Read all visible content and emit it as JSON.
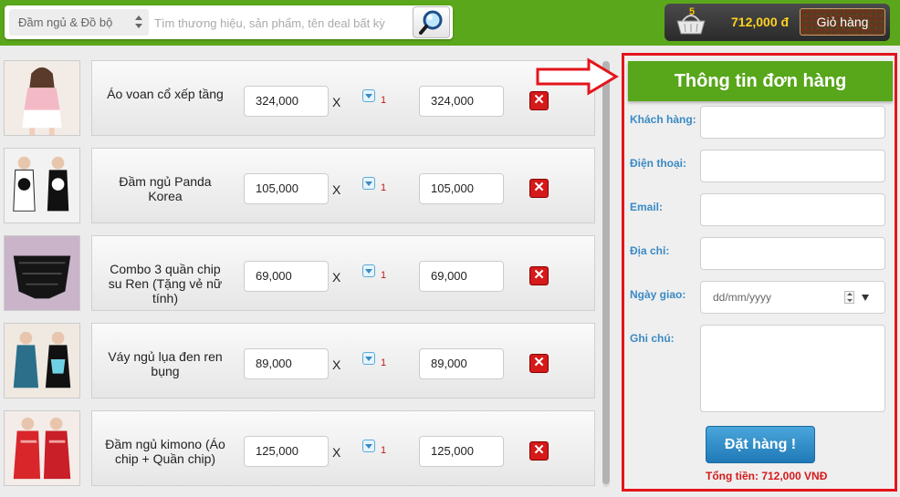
{
  "header": {
    "category_select": "Đầm ngủ & Đồ bộ",
    "search_placeholder": "Tìm thương hiệu, sản phẩm, tên deal bất kỳ",
    "cart_count": "5",
    "cart_total": "712,000 đ",
    "cart_button": "Giỏ hàng"
  },
  "cart_items": [
    {
      "name": "Áo voan cổ xếp tầng",
      "price": "324,000",
      "x": "X",
      "qty": "1",
      "total": "324,000"
    },
    {
      "name": "Đầm ngủ Panda Korea",
      "price": "105,000",
      "x": "X",
      "qty": "1",
      "total": "105,000"
    },
    {
      "name": "Combo 3 quần chip su Ren (Tặng vẻ nữ tính)",
      "price": "69,000",
      "x": "X",
      "qty": "1",
      "total": "69,000"
    },
    {
      "name": "Váy ngủ lụa đen ren bụng",
      "price": "89,000",
      "x": "X",
      "qty": "1",
      "total": "89,000"
    },
    {
      "name": "Đầm ngủ kimono (Áo chip + Quần chip)",
      "price": "125,000",
      "x": "X",
      "qty": "1",
      "total": "125,000"
    }
  ],
  "order_form": {
    "title": "Thông tin đơn hàng",
    "customer_label": "Khách hàng:",
    "phone_label": "Điện thoại:",
    "email_label": "Email:",
    "address_label": "Địa chỉ:",
    "date_label": "Ngày giao:",
    "date_placeholder": "dd/mm/yyyy",
    "note_label": "Ghi chú:",
    "submit": "Đặt hàng !",
    "total": "Tổng tiền: 712,000 VNĐ"
  },
  "colors": {
    "brand_green": "#5ba71b",
    "highlight_red": "#e4141c",
    "label_blue": "#3a8ac4",
    "price_yellow": "#ffd21f"
  },
  "icons": [
    "search-icon",
    "basket-icon",
    "quantity-dropdown-icon",
    "delete-icon",
    "arrow-right-icon",
    "spinner-icon",
    "chevron-down-icon"
  ]
}
